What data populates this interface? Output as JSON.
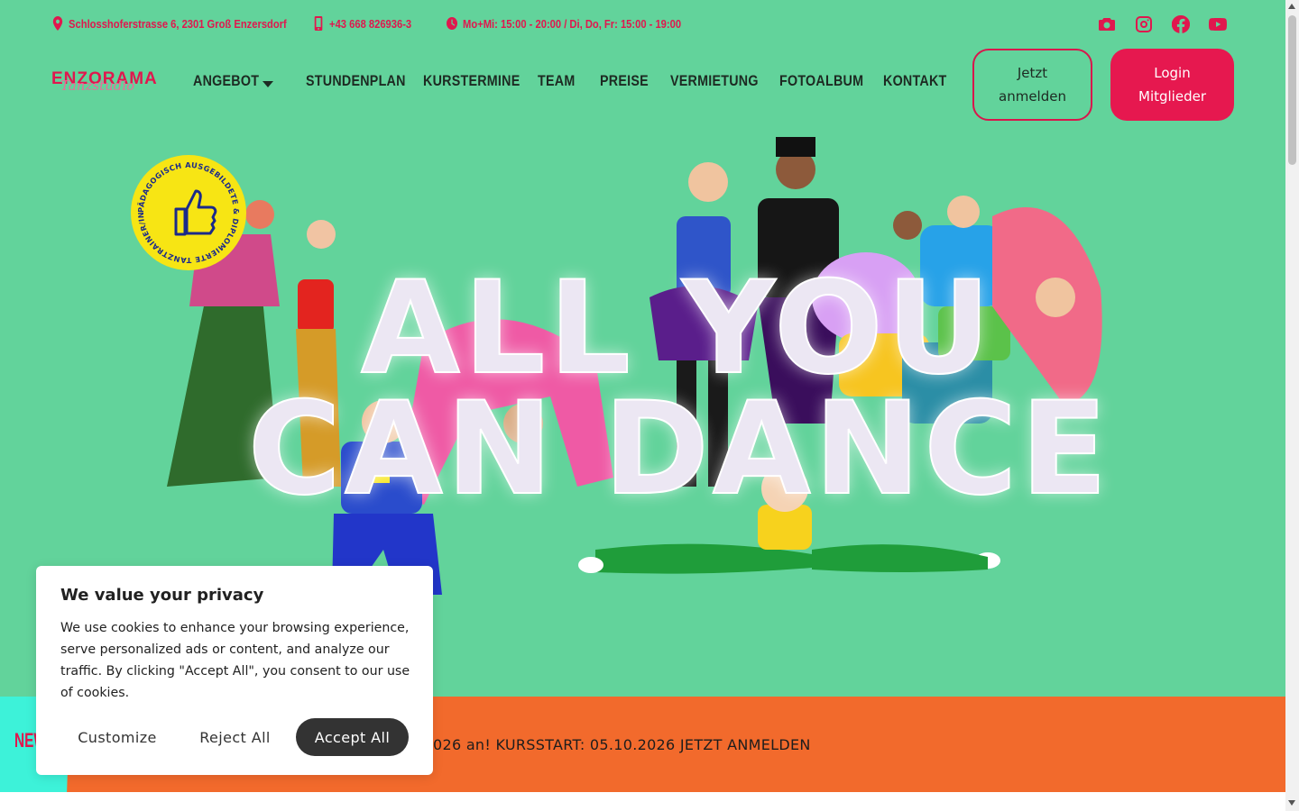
{
  "topbar": {
    "address": "Schlosshoferstrasse 6, 2301 Groß Enzersdorf",
    "phone": "+43 668 826936-3",
    "hours": "Mo+Mi: 15:00 - 20:00 / Di, Do, Fr: 15:00 - 19:00",
    "social": [
      "camera-icon",
      "instagram-icon",
      "facebook-icon",
      "youtube-icon"
    ]
  },
  "header": {
    "logo_main": "ENZORAMA",
    "logo_sub": "Tanzstudio",
    "nav": [
      "ANGEBOT",
      "STUNDENPLAN",
      "KURSTERMINE",
      "TEAM",
      "PREISE",
      "VERMIETUNG",
      "FOTOALBUM",
      "KONTAKT"
    ],
    "cta_register": "Jetzt anmelden",
    "cta_login": "Login Mitglieder"
  },
  "hero": {
    "badge_text": "PÄDAGOGISCH AUSGEBILDETE & DIPLOMIERTE TANZTRAINER/INNEN",
    "headline_line1": "ALL YOU",
    "headline_line2": "CAN DANCE"
  },
  "news": {
    "tag": "NEWS",
    "text": "026 an! KURSSTART: 05.10.2026 JETZT ANMELDEN"
  },
  "cookie": {
    "title": "We value your privacy",
    "body": "We use cookies to enhance your browsing experience, serve personalized ads or content, and analyze our traffic. By clicking \"Accept All\", you consent to our use of cookies.",
    "customize": "Customize",
    "reject": "Reject All",
    "accept": "Accept All"
  },
  "colors": {
    "background": "#62d39b",
    "brand_red": "#e0174e",
    "news_orange": "#f26a2c",
    "news_tag_cyan": "#3df2d9",
    "badge_yellow": "#f7e514"
  }
}
